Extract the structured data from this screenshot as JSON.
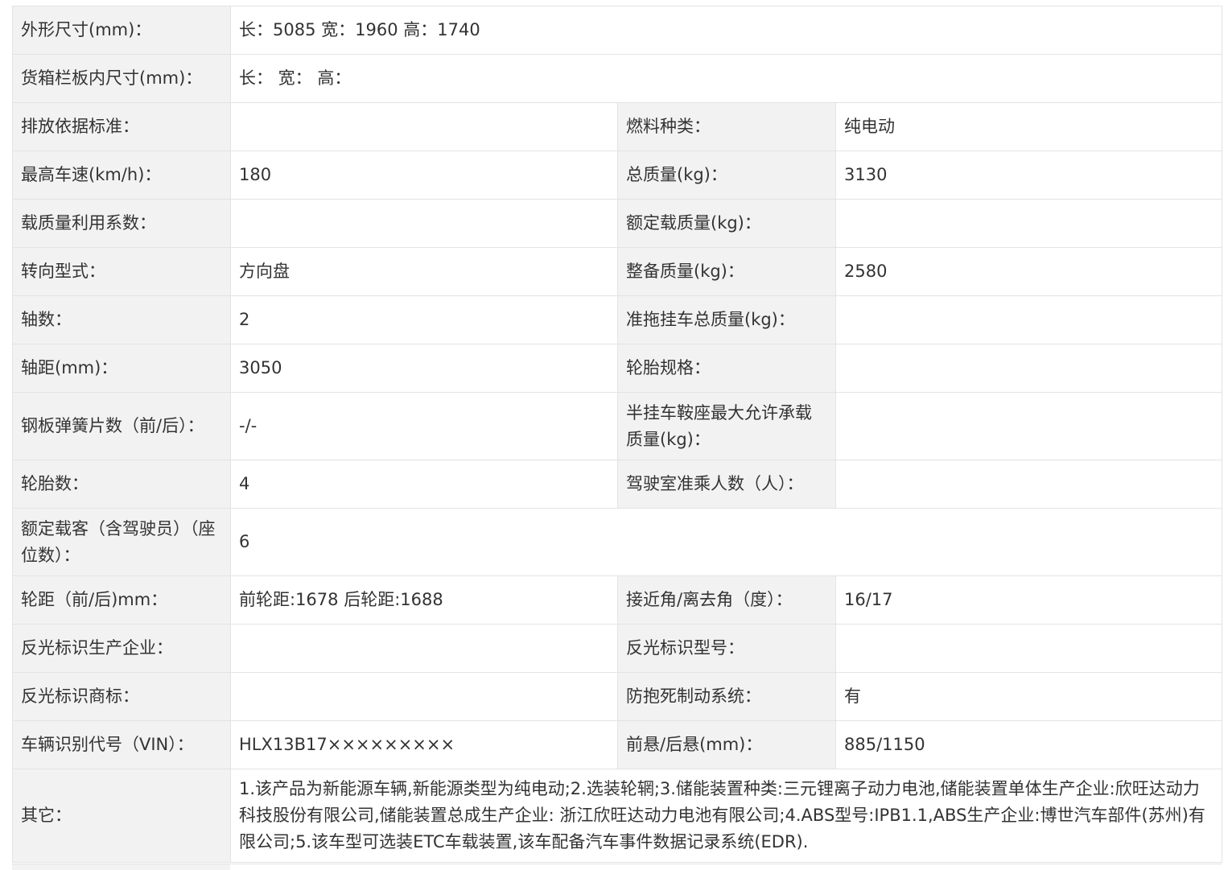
{
  "rows": [
    {
      "h": 60,
      "cells": [
        {
          "text": "外形尺寸(mm)：",
          "kind": "lbl"
        },
        {
          "text": "长：5085 宽：1960 高：1740",
          "kind": "val",
          "span": 3
        }
      ]
    },
    {
      "h": 60,
      "cells": [
        {
          "text": "货箱栏板内尺寸(mm)：",
          "kind": "lbl"
        },
        {
          "text": "长：  宽：  高：",
          "kind": "val",
          "span": 3
        }
      ]
    },
    {
      "h": 60,
      "cells": [
        {
          "text": "排放依据标准：",
          "kind": "lbl"
        },
        {
          "text": "",
          "kind": "val"
        },
        {
          "text": "燃料种类：",
          "kind": "lbl"
        },
        {
          "text": "纯电动",
          "kind": "val"
        }
      ]
    },
    {
      "h": 60,
      "cells": [
        {
          "text": "最高车速(km/h)：",
          "kind": "lbl"
        },
        {
          "text": "180",
          "kind": "val"
        },
        {
          "text": "总质量(kg)：",
          "kind": "lbl"
        },
        {
          "text": "3130",
          "kind": "val"
        }
      ]
    },
    {
      "h": 60,
      "cells": [
        {
          "text": "载质量利用系数：",
          "kind": "lbl"
        },
        {
          "text": "",
          "kind": "val"
        },
        {
          "text": "额定载质量(kg)：",
          "kind": "lbl"
        },
        {
          "text": "",
          "kind": "val"
        }
      ]
    },
    {
      "h": 60,
      "cells": [
        {
          "text": "转向型式：",
          "kind": "lbl"
        },
        {
          "text": "方向盘",
          "kind": "val"
        },
        {
          "text": "整备质量(kg)：",
          "kind": "lbl"
        },
        {
          "text": "2580",
          "kind": "val"
        }
      ]
    },
    {
      "h": 60,
      "cells": [
        {
          "text": "轴数：",
          "kind": "lbl"
        },
        {
          "text": "2",
          "kind": "val"
        },
        {
          "text": "准拖挂车总质量(kg)：",
          "kind": "lbl"
        },
        {
          "text": "",
          "kind": "val"
        }
      ]
    },
    {
      "h": 60,
      "cells": [
        {
          "text": "轴距(mm)：",
          "kind": "lbl"
        },
        {
          "text": "3050",
          "kind": "val"
        },
        {
          "text": "轮胎规格：",
          "kind": "lbl"
        },
        {
          "text": "",
          "kind": "val"
        }
      ]
    },
    {
      "h": 84,
      "cells": [
        {
          "text": "钢板弹簧片数（前/后）：",
          "kind": "lbl"
        },
        {
          "text": "-/-",
          "kind": "val"
        },
        {
          "text": "半挂车鞍座最大允许承载质量(kg)：",
          "kind": "lbl"
        },
        {
          "text": "",
          "kind": "val"
        }
      ]
    },
    {
      "h": 60,
      "cells": [
        {
          "text": "轮胎数：",
          "kind": "lbl"
        },
        {
          "text": "4",
          "kind": "val"
        },
        {
          "text": "驾驶室准乘人数（人）：",
          "kind": "lbl"
        },
        {
          "text": "",
          "kind": "val"
        }
      ]
    },
    {
      "h": 84,
      "cells": [
        {
          "text": "额定载客（含驾驶员）（座位数）：",
          "kind": "lbl"
        },
        {
          "text": "6",
          "kind": "val",
          "span": 3
        }
      ]
    },
    {
      "h": 60,
      "cells": [
        {
          "text": "轮距（前/后)mm：",
          "kind": "lbl"
        },
        {
          "text": "前轮距:1678 后轮距:1688",
          "kind": "val"
        },
        {
          "text": "接近角/离去角（度）：",
          "kind": "lbl"
        },
        {
          "text": "16/17",
          "kind": "val"
        }
      ]
    },
    {
      "h": 60,
      "cells": [
        {
          "text": "反光标识生产企业：",
          "kind": "lbl"
        },
        {
          "text": "",
          "kind": "val"
        },
        {
          "text": "反光标识型号：",
          "kind": "lbl"
        },
        {
          "text": "",
          "kind": "val"
        }
      ]
    },
    {
      "h": 60,
      "cells": [
        {
          "text": "反光标识商标：",
          "kind": "lbl"
        },
        {
          "text": "",
          "kind": "val"
        },
        {
          "text": "防抱死制动系统：",
          "kind": "lbl"
        },
        {
          "text": "有",
          "kind": "val"
        }
      ]
    },
    {
      "h": 60,
      "cells": [
        {
          "text": "车辆识别代号（VIN）：",
          "kind": "lbl"
        },
        {
          "text": "HLX13B17×××××××××",
          "kind": "val"
        },
        {
          "text": "前悬/后悬(mm)：",
          "kind": "lbl"
        },
        {
          "text": "885/1150",
          "kind": "val"
        }
      ]
    },
    {
      "h": 116,
      "cells": [
        {
          "text": "其它：",
          "kind": "lbl"
        },
        {
          "text": "1.该产品为新能源车辆,新能源类型为纯电动;2.选装轮辋;3.储能装置种类:三元锂离子动力电池,储能装置单体生产企业:欣旺达动力科技股份有限公司,储能装置总成生产企业: 浙江欣旺达动力电池有限公司;4.ABS型号:IPB1.1,ABS生产企业:博世汽车部件(苏州)有限公司;5.该车型可选装ETC车载装置,该车配备汽车事件数据记录系统(EDR).",
          "kind": "val",
          "span": 3
        }
      ]
    }
  ]
}
